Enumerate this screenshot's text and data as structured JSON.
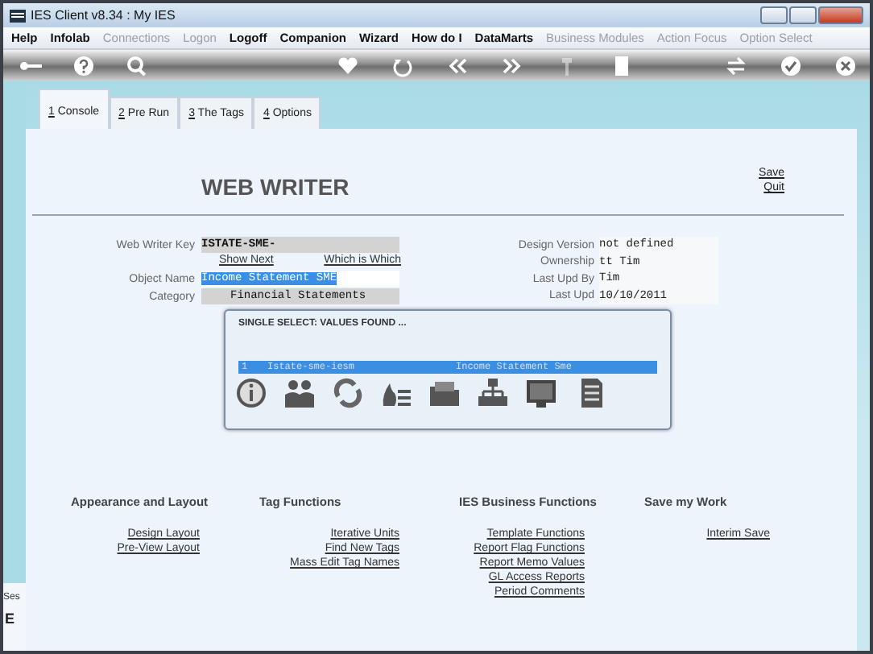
{
  "window": {
    "title": "IES Client v8.34 : My IES"
  },
  "menu": [
    {
      "label": "Help",
      "disabled": false
    },
    {
      "label": "Infolab",
      "disabled": false
    },
    {
      "label": "Connections",
      "disabled": true
    },
    {
      "label": "Logon",
      "disabled": true
    },
    {
      "label": "Logoff",
      "disabled": false
    },
    {
      "label": "Companion",
      "disabled": false
    },
    {
      "label": "Wizard",
      "disabled": false
    },
    {
      "label": "How do I",
      "disabled": false
    },
    {
      "label": "DataMarts",
      "disabled": false
    },
    {
      "label": "Business Modules",
      "disabled": true
    },
    {
      "label": "Action Focus",
      "disabled": true
    },
    {
      "label": "Option Select",
      "disabled": true
    }
  ],
  "toolbar": [
    [
      {
        "kind": "key",
        "disabled": false
      },
      {
        "kind": "help",
        "disabled": false
      },
      {
        "kind": "search",
        "disabled": false
      }
    ],
    [
      {
        "kind": "heart",
        "disabled": false
      },
      {
        "kind": "undo",
        "disabled": false
      },
      {
        "kind": "back",
        "disabled": false
      },
      {
        "kind": "forward",
        "disabled": false
      },
      {
        "kind": "pin",
        "disabled": true
      },
      {
        "kind": "page",
        "disabled": false
      }
    ],
    [
      {
        "kind": "swap",
        "disabled": false
      },
      {
        "kind": "check",
        "disabled": false
      },
      {
        "kind": "close",
        "disabled": false
      }
    ]
  ],
  "tabs": [
    {
      "label": "1 Console",
      "selected": true
    },
    {
      "label": "2 Pre Run",
      "selected": false
    },
    {
      "label": "3 The Tags",
      "selected": false
    },
    {
      "label": "4 Options",
      "selected": false
    }
  ],
  "side": {
    "line_1": "Ses",
    "line_2": "E"
  },
  "title": "WEB WRITER",
  "actions": [
    "Save",
    "Quit"
  ],
  "form": {
    "key_label": "Web Writer Key",
    "key_value": "ISTATE-SME-",
    "links": [
      "Show Next",
      "Which is Which"
    ],
    "object_label": "Object Name",
    "object_value": "Income Statement SME",
    "category_label": "Category",
    "category_value": "Financial Statements",
    "info": [
      {
        "label": "Design Version",
        "value": "not defined"
      },
      {
        "label": "Ownership",
        "value": "tt Tim"
      },
      {
        "label": "Last Upd By",
        "value": "Tim"
      },
      {
        "label": "Last Upd",
        "value": "10/10/2011"
      }
    ]
  },
  "dialog": {
    "title": "SINGLE SELECT: VALUES FOUND ...",
    "rows": [
      {
        "number": "1",
        "key": "Istate-sme-iesm",
        "name": "Income Statement Sme",
        "selected": true
      }
    ],
    "icons": [
      {
        "kind": "info"
      },
      {
        "kind": "people"
      },
      {
        "kind": "refresh"
      },
      {
        "kind": "fire"
      },
      {
        "kind": "folder"
      },
      {
        "kind": "hierarchy"
      },
      {
        "kind": "monitor"
      },
      {
        "kind": "document"
      }
    ]
  },
  "sections": [
    {
      "heading": "Appearance and Layout",
      "links": [
        "Design Layout",
        "Pre-View Layout"
      ]
    },
    {
      "heading": "Tag Functions",
      "links": [
        "Iterative Units",
        "Find New Tags",
        "Mass Edit Tag Names"
      ]
    },
    {
      "heading": "IES Business Functions",
      "links": [
        "Template Functions",
        "Report Flag Functions",
        "Report Memo Values",
        "GL Access Reports",
        "Period Comments"
      ]
    },
    {
      "heading": "Save my Work",
      "links": [
        "Interim Save"
      ]
    }
  ]
}
